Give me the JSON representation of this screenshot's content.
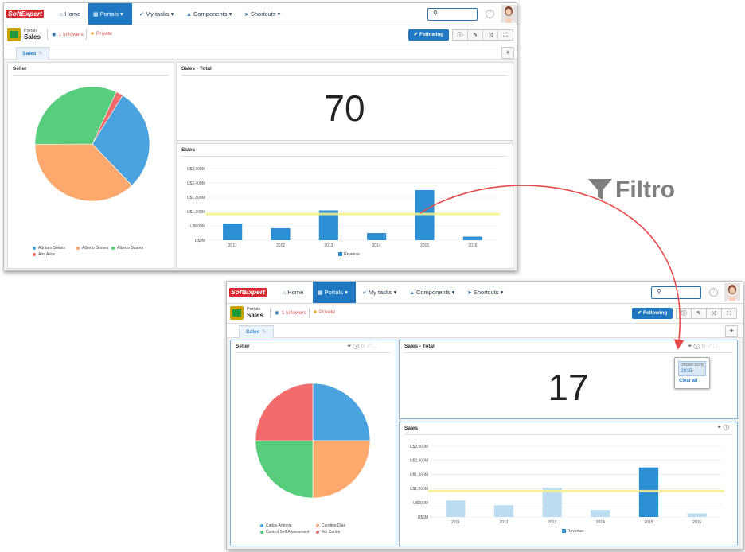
{
  "annotation": {
    "label": "Filtro",
    "color": "#7f7f7f",
    "arrow_color": "#e84b4b"
  },
  "nav": {
    "logo_left": "Soft",
    "logo_right": "Expert",
    "home": "Home",
    "portals": "Portals",
    "tasks": "My tasks",
    "components": "Components",
    "shortcuts": "Shortcuts",
    "accent": "#1f78c1"
  },
  "header": {
    "portal_small": "Portals",
    "portal_name": "Sales",
    "followers": "1 followers",
    "privacy": "Private",
    "follow_button": "✔ Following"
  },
  "tabs": [
    {
      "label": "Sales"
    }
  ],
  "top_window": {
    "seller_title": "Seller",
    "total_title": "Sales - Total",
    "total_value": "70",
    "sales_title": "Sales",
    "pie_legend": [
      "Adriano Solaris",
      "Alberto Gomes",
      "Alberto Soares",
      "Ana Alice"
    ]
  },
  "bottom_window": {
    "seller_title": "Seller",
    "total_title": "Sales - Total",
    "total_value": "17",
    "sales_title": "Sales",
    "pie_legend": [
      "Carlos Antonio",
      "Caroline Dias",
      "Control Self Assessment",
      "Edi Carlos"
    ],
    "filter_popup": {
      "label": "ORDER DATE",
      "value": "2015",
      "clear": "Clear all"
    }
  },
  "chart_data": [
    {
      "type": "pie",
      "title": "Seller",
      "labels": [
        "Adriano Solaris",
        "Alberto Gomes",
        "Alberto Soares",
        "Ana Alice"
      ],
      "values": [
        29,
        37,
        32,
        2
      ],
      "colors": [
        "#4aa3df",
        "#fda96d",
        "#58cd7c",
        "#f26b6b"
      ]
    },
    {
      "type": "bar",
      "title": "Sales",
      "categories": [
        "2011",
        "2012",
        "2013",
        "2014",
        "2015",
        "2016"
      ],
      "series": [
        {
          "name": "Revenue",
          "values": [
            700,
            500,
            1250,
            300,
            2100,
            150
          ]
        }
      ],
      "reference_line": 1100,
      "y_ticks": [
        "U$0M",
        "U$600M",
        "U$1,200M",
        "U$1,800M",
        "U$2,400M",
        "U$3,000M"
      ],
      "ylim": [
        0,
        3000
      ],
      "color": "#2c8fd3",
      "reference_color": "#f7f08a"
    },
    {
      "type": "pie",
      "title": "Seller",
      "labels": [
        "Carlos Antonio",
        "Caroline Dias",
        "Control Self Assessment",
        "Edi Carlos"
      ],
      "values": [
        25,
        25,
        25,
        25
      ],
      "colors": [
        "#4aa3df",
        "#fda96d",
        "#58cd7c",
        "#f26b6b"
      ]
    },
    {
      "type": "bar",
      "title": "Sales",
      "categories": [
        "2011",
        "2012",
        "2013",
        "2014",
        "2015",
        "2016"
      ],
      "series": [
        {
          "name": "Revenue",
          "values": [
            700,
            500,
            1250,
            300,
            2100,
            150
          ]
        }
      ],
      "highlighted_category": "2015",
      "reference_line": 1100,
      "y_ticks": [
        "U$0M",
        "U$600M",
        "U$1,200M",
        "U$1,800M",
        "U$2,400M",
        "U$3,000M"
      ],
      "ylim": [
        0,
        3000
      ],
      "color": "#2c8fd3",
      "dim_color": "#bcdcf2",
      "reference_color": "#f7f08a"
    }
  ]
}
